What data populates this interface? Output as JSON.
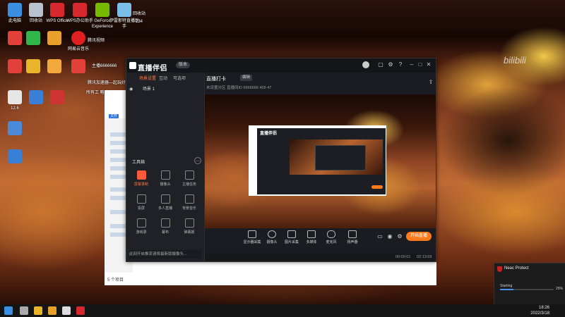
{
  "watermark": "bilibili",
  "desktop": {
    "icons": [
      {
        "label": "此电脑",
        "color": "#3b8fe0"
      },
      {
        "label": "回收站",
        "color": "#b9c3cf"
      },
      {
        "label": "WPS Office",
        "color": "#d8282f"
      },
      {
        "label": "WPS办公助手",
        "color": "#d8282f"
      },
      {
        "label": "GeForce Experience",
        "color": "#76b900"
      },
      {
        "label": "伊雷那特直播助手",
        "color": "#7bbfe8"
      },
      {
        "label": "",
        "color": "#e2403a"
      },
      {
        "label": "",
        "color": "#2fb54a"
      },
      {
        "label": "",
        "color": "#e9a02b"
      },
      {
        "label": "网易云音乐",
        "color": "#e02020"
      },
      {
        "label": "",
        "color": "#e8b42a"
      },
      {
        "label": "",
        "color": "#e2403a"
      },
      {
        "label": "",
        "color": "#e2403a"
      },
      {
        "label": "",
        "color": "#f3a83b"
      },
      {
        "label": "12.6",
        "color": "#e6e6e6"
      },
      {
        "label": "",
        "color": "#3a7fd6"
      },
      {
        "label": "",
        "color": "#cf3434"
      },
      {
        "label": "",
        "color": "#4b8ad8"
      }
    ],
    "lines": [
      "主播6666666",
      "所有工 略略",
      "腾讯视频",
      "腾讯加速器—起玩好玩"
    ],
    "top_right_label": "回收站",
    "top_right_num": "234"
  },
  "explorer": {
    "tab": "文件",
    "status": "5 个项目"
  },
  "app": {
    "name": "直播伴侣",
    "version_badge": "版本",
    "left_tabs": [
      "场景设置",
      "互动",
      "可选项"
    ],
    "scene": "场景 1",
    "tools_title": "工具箱",
    "tools": [
      {
        "label": "屏幕录制",
        "icon": "screen-record-icon",
        "hot": true
      },
      {
        "label": "摄像头",
        "icon": "camera-icon",
        "hot": false
      },
      {
        "label": "主播任务",
        "icon": "task-icon",
        "hot": false
      },
      {
        "label": "投屏",
        "icon": "cast-icon",
        "hot": false
      },
      {
        "label": "多人直播",
        "icon": "multi-live-icon",
        "hot": false
      },
      {
        "label": "背景音乐",
        "icon": "music-icon",
        "hot": false
      },
      {
        "label": "游戏录",
        "icon": "game-icon",
        "hot": false
      },
      {
        "label": "幕布",
        "icon": "curtain-icon",
        "hot": false
      },
      {
        "label": "弹幕姬",
        "icon": "danmaku-icon",
        "hot": false
      }
    ],
    "left_footer": "此刻开启推流请将最新版摄像头...",
    "room_title": "直播打卡",
    "room_tag": "编辑",
    "room_meta": "未设置分区  直播间ID 6666666  409  47",
    "controls": [
      "显示器采集",
      "摄像头",
      "图片采集",
      "多媒体",
      "麦克风",
      "扬声器"
    ],
    "start_label": "开始直播",
    "status_text": "00:00:01",
    "status_time": "02:13:09"
  },
  "neac": {
    "title": "Neac Protect",
    "status": "Starting",
    "percent_text": "25%",
    "progress": 0.25
  },
  "taskbar": {
    "time": "18:26",
    "date": "2022/3/18"
  }
}
